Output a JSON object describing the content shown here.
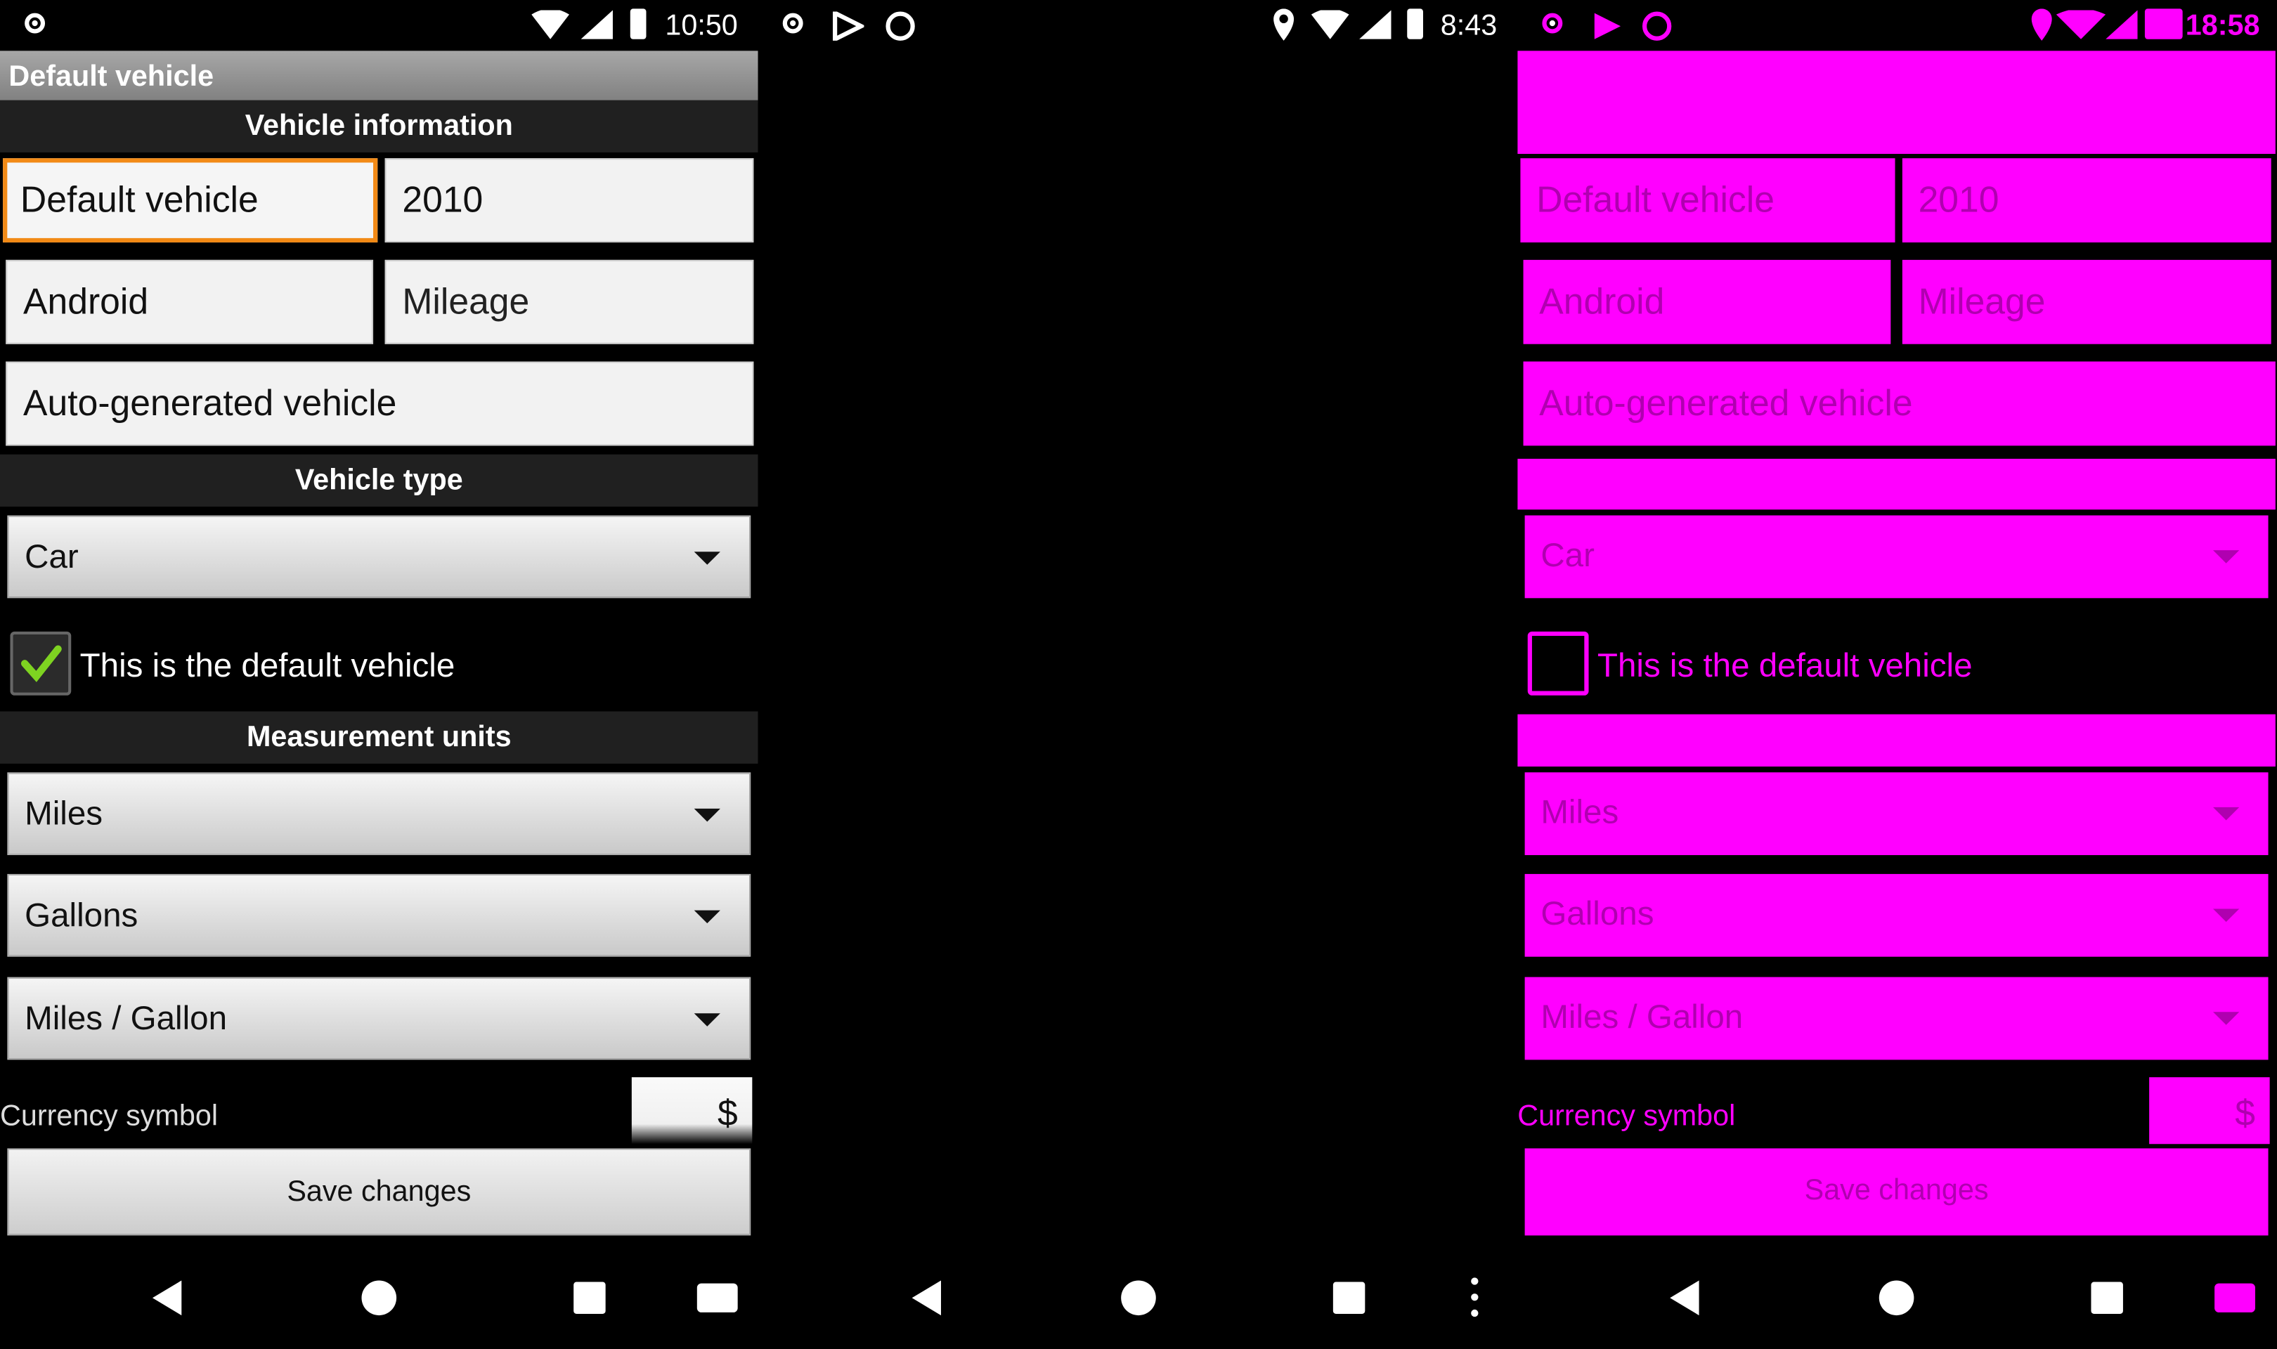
{
  "panel1": {
    "status": {
      "time": "10:50"
    },
    "title": "Default vehicle",
    "sections": {
      "vehicle_info": "Vehicle information",
      "vehicle_type": "Vehicle type",
      "units": "Measurement units"
    },
    "fields": {
      "name": "Default vehicle",
      "year": "2010",
      "make": "Android",
      "mileage_placeholder": "Mileage",
      "description": "Auto-generated vehicle"
    },
    "vehicle_type": "Car",
    "default_checkbox": {
      "label": "This is the default vehicle",
      "checked": true
    },
    "units": {
      "distance": "Miles",
      "volume": "Gallons",
      "economy": "Miles / Gallon"
    },
    "currency": {
      "label": "Currency symbol",
      "value": "$"
    },
    "save_label": "Save changes"
  },
  "panel2": {
    "status": {
      "time": "8:43"
    }
  },
  "panel3": {
    "status": {
      "time": "18:58"
    },
    "fields": {
      "name": "Default vehicle",
      "year": "2010",
      "make": "Android",
      "mileage_placeholder": "Mileage",
      "description": "Auto-generated vehicle"
    },
    "vehicle_type": "Car",
    "default_checkbox": {
      "label": "This is the default vehicle",
      "checked": false
    },
    "units": {
      "distance": "Miles",
      "volume": "Gallons",
      "economy": "Miles / Gallon"
    },
    "currency": {
      "label": "Currency symbol",
      "value": "$"
    },
    "save_label": "Save changes",
    "accent_color": "#ff00ff"
  },
  "colors": {
    "focus_border": "#f28a16",
    "checkmark": "#7ed321",
    "magenta": "#ff00ff"
  }
}
